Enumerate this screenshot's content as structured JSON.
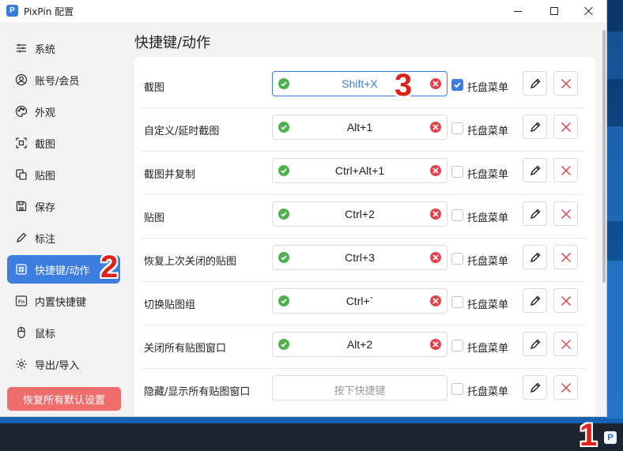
{
  "window": {
    "title": "PixPin 配置",
    "app_logo": "P"
  },
  "sidebar": {
    "items": [
      {
        "label": "系统",
        "icon": "sliders-icon"
      },
      {
        "label": "账号/会员",
        "icon": "user-icon"
      },
      {
        "label": "外观",
        "icon": "palette-icon"
      },
      {
        "label": "截图",
        "icon": "screenshot-icon"
      },
      {
        "label": "贴图",
        "icon": "pin-window-icon"
      },
      {
        "label": "保存",
        "icon": "save-icon"
      },
      {
        "label": "标注",
        "icon": "pen-icon"
      },
      {
        "label": "快捷键/动作",
        "icon": "hash-icon",
        "active": true
      },
      {
        "label": "内置快捷键",
        "icon": "fn-key-icon"
      },
      {
        "label": "鼠标",
        "icon": "mouse-icon"
      },
      {
        "label": "导出/导入",
        "icon": "gear-icon"
      }
    ],
    "reset_button": "恢复所有默认设置"
  },
  "main": {
    "title": "快捷键/动作",
    "rows": [
      {
        "label": "截图",
        "hotkey": "Shift+X",
        "tray_label": "托盘菜单",
        "tray_checked": true,
        "focused": true
      },
      {
        "label": "自定义/延时截图",
        "hotkey": "Alt+1",
        "tray_label": "托盘菜单",
        "tray_checked": false
      },
      {
        "label": "截图并复制",
        "hotkey": "Ctrl+Alt+1",
        "tray_label": "托盘菜单",
        "tray_checked": false
      },
      {
        "label": "贴图",
        "hotkey": "Ctrl+2",
        "tray_label": "托盘菜单",
        "tray_checked": false
      },
      {
        "label": "恢复上次关闭的贴图",
        "hotkey": "Ctrl+3",
        "tray_label": "托盘菜单",
        "tray_checked": false
      },
      {
        "label": "切换贴图组",
        "hotkey": "Ctrl+`",
        "tray_label": "托盘菜单",
        "tray_checked": false
      },
      {
        "label": "关闭所有贴图窗口",
        "hotkey": "Alt+2",
        "tray_label": "托盘菜单",
        "tray_checked": false
      },
      {
        "label": "隐藏/显示所有贴图窗口",
        "hotkey": "",
        "placeholder": "按下快捷键",
        "tray_label": "托盘菜单",
        "tray_checked": false
      }
    ]
  },
  "annotations": [
    "1",
    "2",
    "3"
  ],
  "taskbar": {
    "tray_icon_letter": "P"
  },
  "colors": {
    "accent": "#3d7de0",
    "danger": "#e0444a",
    "reset": "#ee6e6e",
    "ok": "#4db14d"
  }
}
